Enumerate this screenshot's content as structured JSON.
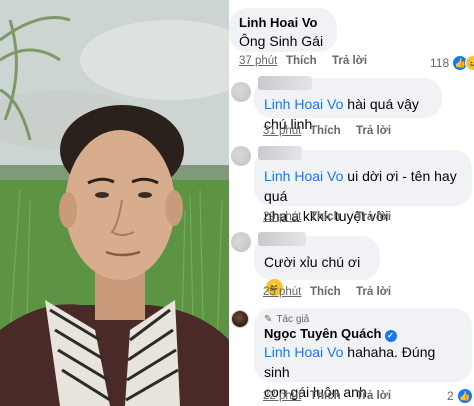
{
  "photo": {
    "alt_subject": "man-in-rice-field"
  },
  "comments": [
    {
      "author": "Linh Hoai Vo",
      "text": "Ông Sinh Gái",
      "time": "37 phút",
      "like_label": "Thích",
      "reply_label": "Trả lời",
      "reaction_count": "118"
    },
    {
      "author_hidden": true,
      "mention": "Linh Hoai Vo",
      "text": " hài quá vậy chú linh",
      "time": "31 phút",
      "like_label": "Thích",
      "reply_label": "Trả lời"
    },
    {
      "author_hidden": true,
      "mention": "Linh Hoai Vo",
      "text_line1": " ui dời ơi - tên hay quá",
      "text_line2": "nha a kkkk tuyệt vời",
      "time": "29 phút",
      "like_label": "Thích",
      "reply_label": "Trả lời"
    },
    {
      "author_hidden": true,
      "text": "Cười xỉu chú ơi",
      "time": "25 phút",
      "like_label": "Thích",
      "reply_label": "Trả lời"
    },
    {
      "badge": "Tác giả",
      "author": "Ngọc Tuyên Quách",
      "mention": "Linh Hoai Vo",
      "text_line1": " hahaha. Đúng sinh",
      "text_line2": "con gái luôn anh.",
      "time": "22 phút",
      "like_label": "Thích",
      "reply_label": "Trả lời",
      "reaction_count": "2"
    }
  ],
  "colors": {
    "mention": "#1877f2",
    "bubble": "#f0f2f5",
    "meta": "#65676b"
  },
  "icons": [
    "like-icon",
    "haha-icon",
    "verified-icon",
    "laughing-emoji",
    "pen-icon"
  ]
}
